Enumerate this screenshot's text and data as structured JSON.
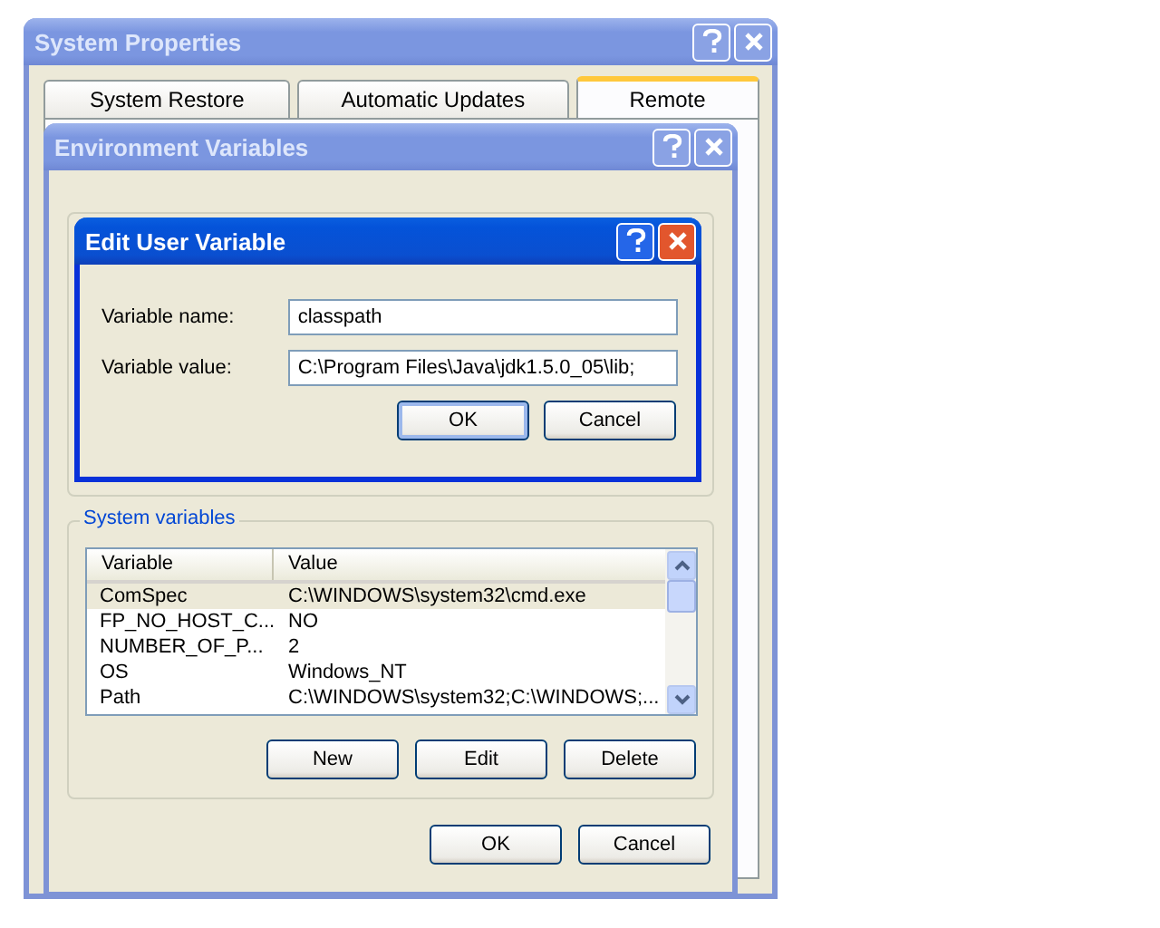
{
  "system_properties": {
    "title": "System Properties",
    "active": false,
    "tabs": [
      {
        "label": "System Restore",
        "selected": false
      },
      {
        "label": "Automatic Updates",
        "selected": false
      },
      {
        "label": "Remote",
        "selected": true
      }
    ]
  },
  "environment_variables": {
    "title": "Environment Variables",
    "active": false,
    "system_variables": {
      "label": "System variables",
      "columns": [
        "Variable",
        "Value"
      ],
      "rows": [
        {
          "variable": "ComSpec",
          "value": "C:\\WINDOWS\\system32\\cmd.exe",
          "selected": true
        },
        {
          "variable": "FP_NO_HOST_C...",
          "value": "NO",
          "selected": false
        },
        {
          "variable": "NUMBER_OF_P...",
          "value": "2",
          "selected": false
        },
        {
          "variable": "OS",
          "value": "Windows_NT",
          "selected": false
        },
        {
          "variable": "Path",
          "value": "C:\\WINDOWS\\system32;C:\\WINDOWS;...",
          "selected": false
        }
      ],
      "buttons": [
        "New",
        "Edit",
        "Delete"
      ]
    },
    "buttons": [
      "OK",
      "Cancel"
    ]
  },
  "edit_user_variable": {
    "title": "Edit User Variable",
    "active": true,
    "fields": [
      {
        "label": "Variable name:",
        "value": "classpath"
      },
      {
        "label": "Variable value:",
        "value": "C:\\Program Files\\Java\\jdk1.5.0_05\\lib;"
      }
    ],
    "buttons": [
      {
        "label": "OK",
        "default": true
      },
      {
        "label": "Cancel",
        "default": false
      }
    ]
  }
}
